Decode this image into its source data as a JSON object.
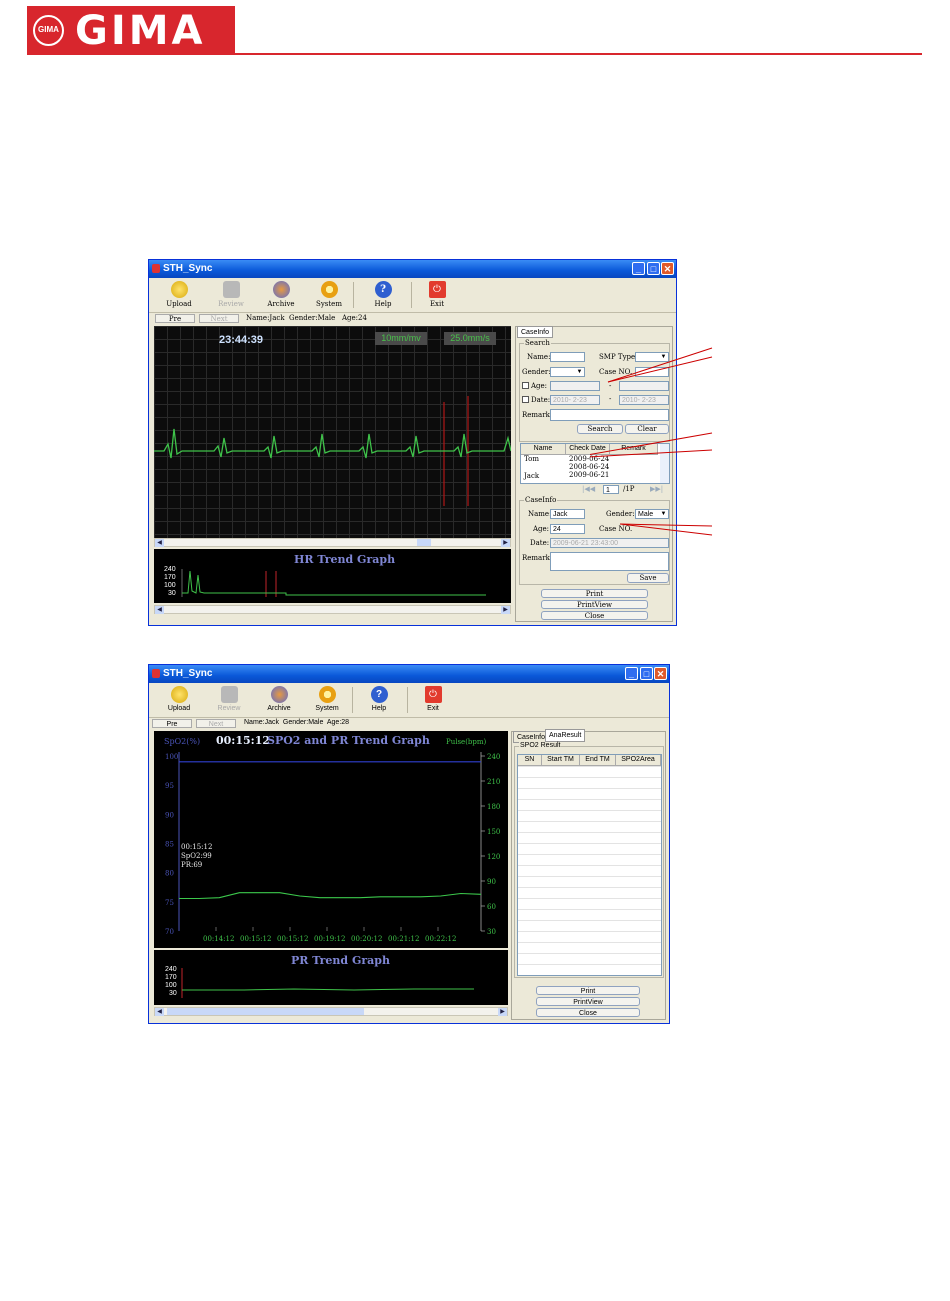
{
  "logo": {
    "brand": "GIMA",
    "mark": "GIMA"
  },
  "window1": {
    "title": "STH_Sync",
    "toolbar": [
      {
        "label": "Upload",
        "icon": "upload-icon",
        "enabled": true
      },
      {
        "label": "Review",
        "icon": "review-icon",
        "enabled": false
      },
      {
        "label": "Archive",
        "icon": "archive-icon",
        "enabled": true
      },
      {
        "label": "System",
        "icon": "system-icon",
        "enabled": true
      },
      {
        "label": "Help",
        "icon": "help-icon",
        "enabled": true
      },
      {
        "label": "Exit",
        "icon": "exit-icon",
        "enabled": true
      }
    ],
    "nav": {
      "pre": "Pre",
      "next": "Next",
      "name": "Name:Jack",
      "gender": "Gender:Male",
      "age": "Age:24"
    },
    "ecg": {
      "time": "23:44:39",
      "gain": "10mm/mv",
      "speed": "25.0mm/s"
    },
    "hr_trend": {
      "title": "HR Trend Graph",
      "yticks": [
        "240",
        "170",
        "100",
        "30"
      ]
    },
    "tab": "CaseInfo",
    "search": {
      "group": "Search",
      "name_label": "Name:",
      "smp_type_label": "SMP Type:",
      "gender_label": "Gender:",
      "case_no_label": "Case NO.",
      "age_label": "Age:",
      "date_label": "Date:",
      "date_from": "2010- 2-23",
      "date_to": "2010- 2-23",
      "remark_label": "Remark:",
      "search_btn": "Search",
      "clear_btn": "Clear"
    },
    "list": {
      "headers": [
        "Name",
        "Check Date",
        "Remark"
      ],
      "rows": [
        [
          "Tom",
          "2009-06-24",
          ""
        ],
        [
          "",
          "2008-06-24",
          ""
        ],
        [
          "Jack",
          "2009-06-21",
          ""
        ]
      ],
      "page": "1",
      "pages": "/1P"
    },
    "caseinfo": {
      "group": "CaseInfo",
      "name_label": "Name:",
      "name": "Jack",
      "gender_label": "Gender:",
      "gender": "Male",
      "age_label": "Age:",
      "age": "24",
      "case_label": "Case NO.",
      "date_label": "Date:",
      "date": "2009-06-21 23:43:00",
      "remark_label": "Remark:",
      "save_btn": "Save"
    },
    "buttons": {
      "print": "Print",
      "printview": "PrintView",
      "close": "Close"
    }
  },
  "window2": {
    "title": "STH_Sync",
    "toolbar": [
      {
        "label": "Upload",
        "icon": "upload-icon",
        "enabled": true
      },
      {
        "label": "Review",
        "icon": "review-icon",
        "enabled": false
      },
      {
        "label": "Archive",
        "icon": "archive-icon",
        "enabled": true
      },
      {
        "label": "System",
        "icon": "system-icon",
        "enabled": true
      },
      {
        "label": "Help",
        "icon": "help-icon",
        "enabled": true
      },
      {
        "label": "Exit",
        "icon": "exit-icon",
        "enabled": true
      }
    ],
    "nav": {
      "pre": "Pre",
      "next": "Next",
      "info": "Name:Jack  Gender:Male  Age:28"
    },
    "tabs": [
      "CaseInfo",
      "AnaResult"
    ],
    "spo2_result": {
      "group": "SPO2 Result",
      "headers": [
        "SN",
        "Start TM",
        "End TM",
        "SPO2Area"
      ]
    },
    "pr_trend": {
      "title": "PR Trend Graph",
      "yticks": [
        "240",
        "170",
        "100",
        "30"
      ]
    },
    "buttons": {
      "print": "Print",
      "printview": "PrintView",
      "close": "Close"
    }
  },
  "chart_data": {
    "type": "line",
    "title": "SPO2 and PR Trend Graph",
    "time_label": "00:15:12",
    "ylabel_left": "SpO2(%)",
    "ylabel_right": "Pulse(bpm)",
    "y_left_ticks": [
      100,
      95,
      90,
      85,
      80,
      75,
      70
    ],
    "y_right_ticks": [
      240,
      210,
      180,
      150,
      120,
      90,
      60,
      30
    ],
    "x_ticks": [
      "00:14:12",
      "00:15:12",
      "00:15:12",
      "00:19:12",
      "00:20:12",
      "00:21:12",
      "00:22:12"
    ],
    "readout": [
      "00:15:12",
      "SpO2:99",
      "PR:69"
    ],
    "series": [
      {
        "color": "#3040d0",
        "values": [
          99,
          99,
          99,
          99,
          99,
          99,
          99,
          99,
          99,
          99,
          99,
          99,
          99,
          99,
          99,
          99
        ]
      },
      {
        "color": "#3cc84c",
        "values": [
          69,
          69,
          70,
          76,
          76,
          76,
          72,
          70,
          70,
          70,
          71,
          71,
          71,
          72,
          75,
          74
        ]
      }
    ]
  }
}
